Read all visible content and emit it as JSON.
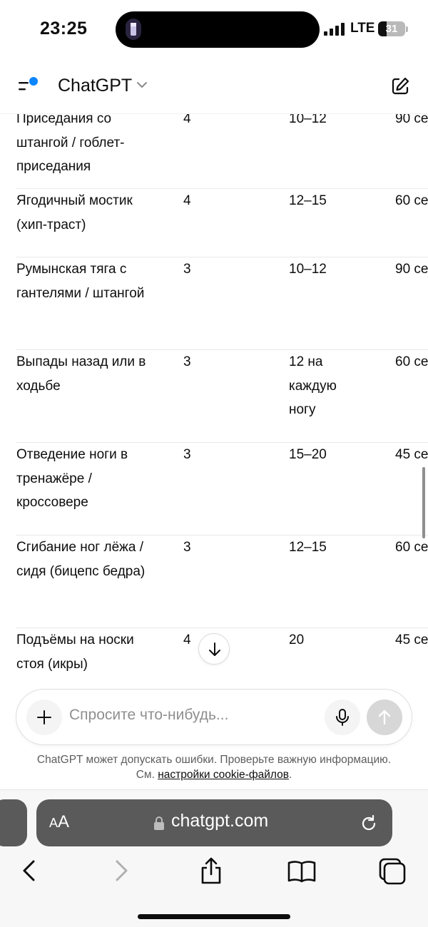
{
  "status_bar": {
    "time": "23:25",
    "network": "LTE",
    "battery": "31",
    "battery_level": 0.31
  },
  "header": {
    "title": "ChatGPT",
    "icons": {
      "menu": "menu-icon",
      "dropdown": "chevron-down-icon",
      "new_chat": "new-chat-icon"
    },
    "notification_dot_color": "#0a84ff"
  },
  "table": {
    "rows": [
      {
        "name": "Приседания со штангой / гоблет-приседания",
        "sets": "4",
        "reps": "10–12",
        "rest": "90 се"
      },
      {
        "name": "Ягодичный мостик (хип-траст)",
        "sets": "4",
        "reps": "12–15",
        "rest": "60 се"
      },
      {
        "name": "Румынская тяга с гантелями / штангой",
        "sets": "3",
        "reps": "10–12",
        "rest": "90 се"
      },
      {
        "name": "Выпады назад или в ходьбе",
        "sets": "3",
        "reps": "12 на каждую ногу",
        "rest": "60 се"
      },
      {
        "name": "Отведение ноги в тренажёре / кроссовере",
        "sets": "3",
        "reps": "15–20",
        "rest": "45 се"
      },
      {
        "name": "Сгибание ног лёжа / сидя (бицепс бедра)",
        "sets": "3",
        "reps": "12–15",
        "rest": "60 се"
      },
      {
        "name": "Подъёмы на носки стоя (икры)",
        "sets": "4",
        "reps": "20",
        "rest": "45 се"
      }
    ]
  },
  "composer": {
    "placeholder": "Спросите что-нибудь...",
    "icons": {
      "add": "plus-icon",
      "mic": "mic-icon",
      "send": "arrow-up-icon"
    }
  },
  "disclaimer": {
    "text": "ChatGPT может допускать ошибки. Проверьте важную информацию.",
    "see": "См.",
    "link": "настройки cookie-файлов",
    "end": "."
  },
  "browser": {
    "text_size_small": "A",
    "text_size_large": "A",
    "address": "chatgpt.com",
    "icons": {
      "lock": "lock-icon",
      "reload": "reload-icon",
      "back": "chevron-left-icon",
      "forward": "chevron-right-icon",
      "share": "share-icon",
      "bookmarks": "book-icon",
      "tabs": "tabs-icon"
    }
  },
  "colors": {
    "accent_blue": "#0a84ff",
    "browser_bar": "#5a5a5a",
    "send_disabled": "#d7d7d7"
  }
}
